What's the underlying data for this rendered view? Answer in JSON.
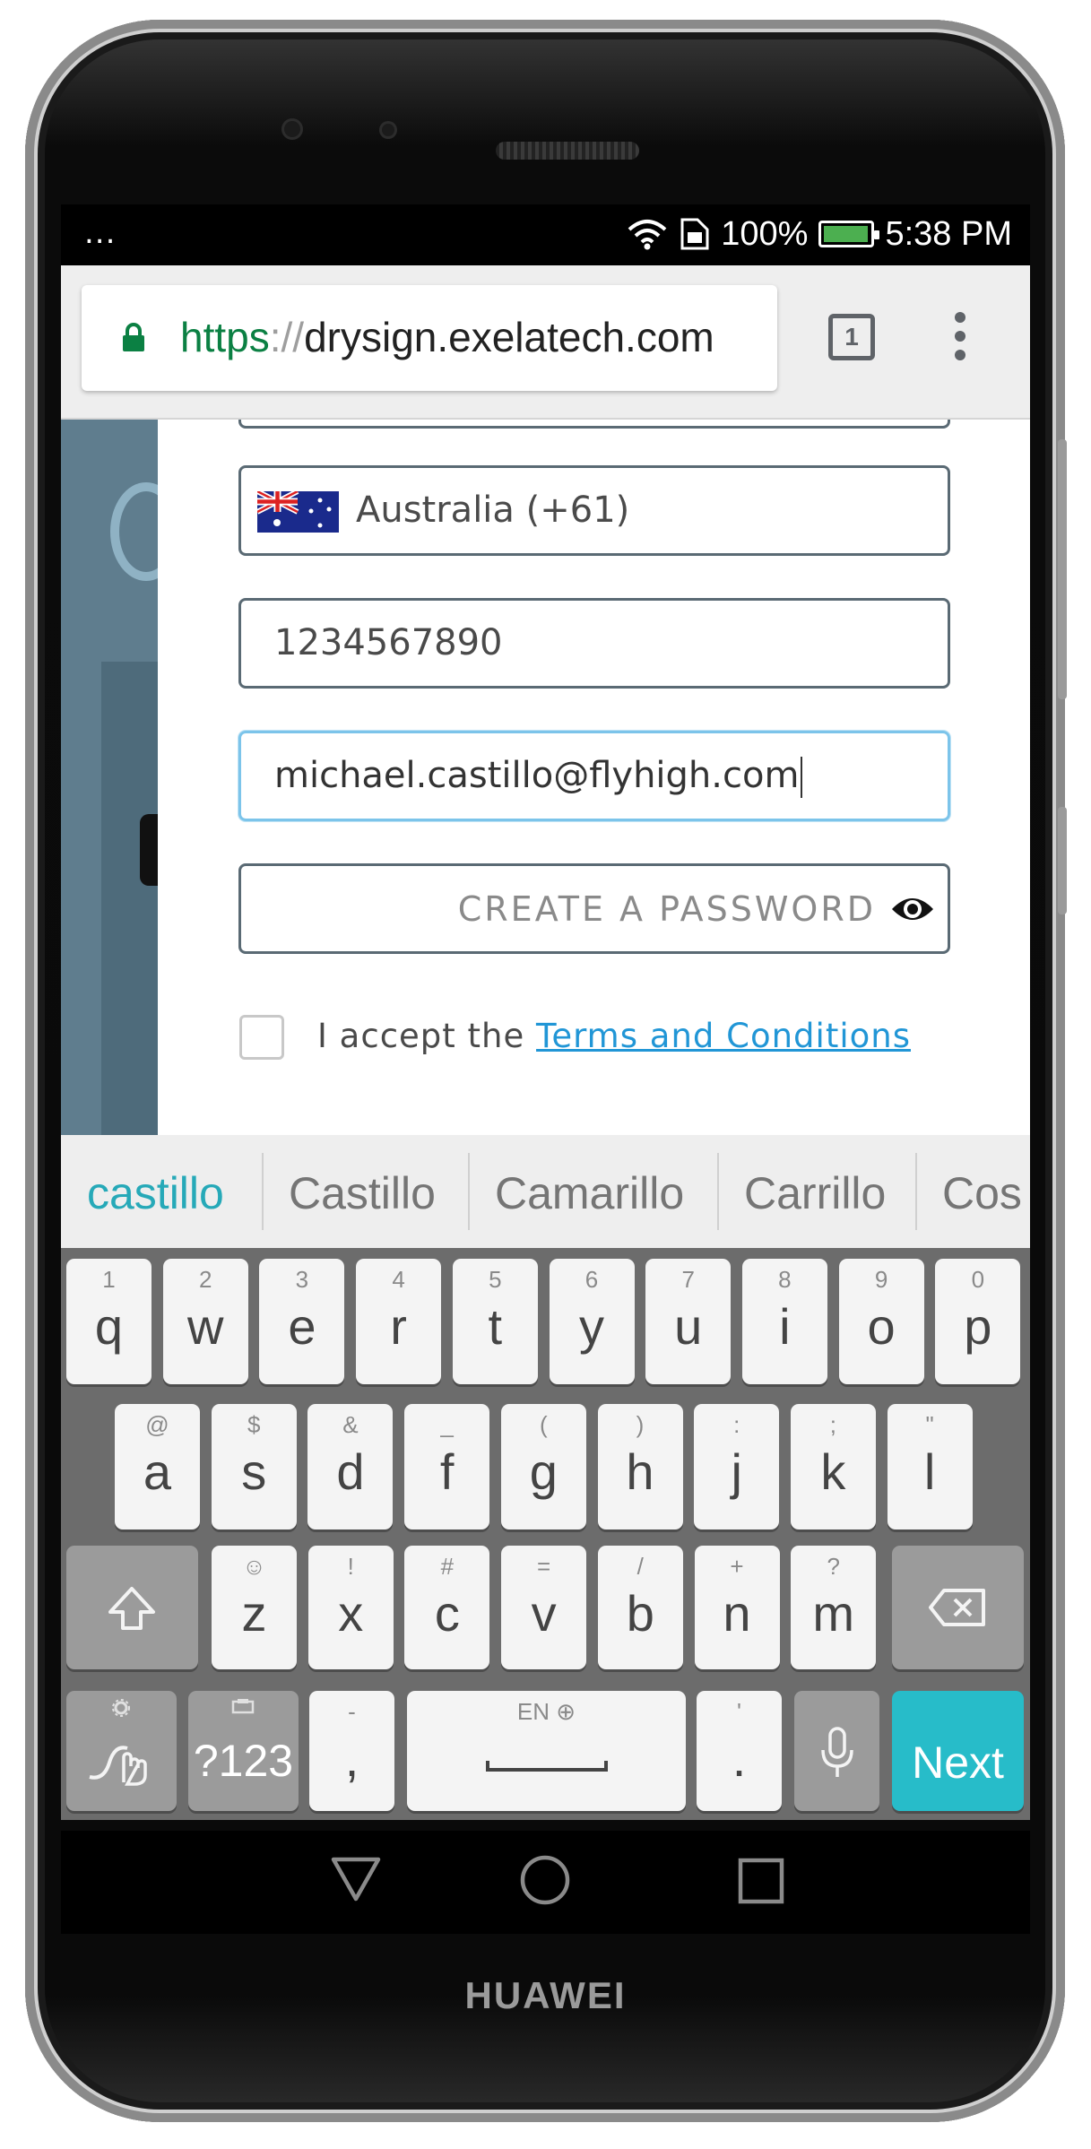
{
  "device": {
    "brand": "HUAWEI"
  },
  "status_bar": {
    "notification_dots": "...",
    "battery_percent": "100%",
    "time": "5:38 PM"
  },
  "browser": {
    "url_scheme": "https",
    "url_separator": "://",
    "url_host": "drysign.exelatech.com",
    "tab_count": "1",
    "icons": [
      "lock-icon",
      "tab-switcher-icon",
      "menu-dots-icon"
    ]
  },
  "form": {
    "country": {
      "flag": "australia-flag-icon",
      "value": "Australia (+61)"
    },
    "phone": {
      "value": "1234567890"
    },
    "email": {
      "value": "michael.castillo@flyhigh.com"
    },
    "password": {
      "placeholder": "CREATE A PASSWORD",
      "icon": "eye-icon"
    },
    "terms": {
      "checked": false,
      "prefix": "I accept the",
      "link": "Terms and Conditions"
    }
  },
  "keyboard": {
    "suggestions": [
      "castillo",
      "Castillo",
      "Camarillo",
      "Carrillo",
      "Cos"
    ],
    "row1": [
      {
        "key": "q",
        "hint": "1"
      },
      {
        "key": "w",
        "hint": "2"
      },
      {
        "key": "e",
        "hint": "3"
      },
      {
        "key": "r",
        "hint": "4"
      },
      {
        "key": "t",
        "hint": "5"
      },
      {
        "key": "y",
        "hint": "6"
      },
      {
        "key": "u",
        "hint": "7"
      },
      {
        "key": "i",
        "hint": "8"
      },
      {
        "key": "o",
        "hint": "9"
      },
      {
        "key": "p",
        "hint": "0"
      }
    ],
    "row2": [
      {
        "key": "a",
        "hint": "@"
      },
      {
        "key": "s",
        "hint": "$"
      },
      {
        "key": "d",
        "hint": "&"
      },
      {
        "key": "f",
        "hint": "_"
      },
      {
        "key": "g",
        "hint": "("
      },
      {
        "key": "h",
        "hint": ")"
      },
      {
        "key": "j",
        "hint": ":"
      },
      {
        "key": "k",
        "hint": ";"
      },
      {
        "key": "l",
        "hint": "\""
      }
    ],
    "row3": [
      {
        "key": "z",
        "hint": "☺"
      },
      {
        "key": "x",
        "hint": "!"
      },
      {
        "key": "c",
        "hint": "#"
      },
      {
        "key": "v",
        "hint": "="
      },
      {
        "key": "b",
        "hint": "/"
      },
      {
        "key": "n",
        "hint": "+"
      },
      {
        "key": "m",
        "hint": "?"
      }
    ],
    "symbols_label": "?123",
    "comma": {
      "key": ",",
      "hint": "-"
    },
    "period": {
      "key": ".",
      "hint": "'"
    },
    "space_hint": "EN ⊕",
    "action_label": "Next",
    "accent_color": "#27bcc9"
  }
}
